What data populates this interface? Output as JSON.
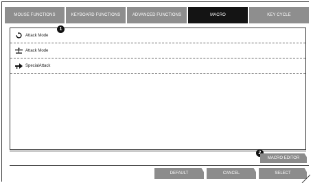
{
  "tabs": [
    {
      "label": "MOUSE FUNCTIONS",
      "active": false
    },
    {
      "label": "KEYBOARD FUNCTIONS",
      "active": false
    },
    {
      "label": "ADVANCED FUNCTIONS",
      "active": false
    },
    {
      "label": "MACRO",
      "active": true
    },
    {
      "label": "KEY CYCLE",
      "active": false
    }
  ],
  "macros": [
    {
      "label": "Attack Mode",
      "icon": "circular-arrows-icon"
    },
    {
      "label": "Attack Mode",
      "icon": "balance-scale-icon"
    },
    {
      "label": "SpecialAttack",
      "icon": "arrow-right-icon"
    }
  ],
  "badges": {
    "one": "1",
    "two": "2"
  },
  "buttons": {
    "macro_editor": "MACRO EDITOR",
    "default": "DEFAULT",
    "cancel": "CANCEL",
    "select": "SELECT"
  },
  "colors": {
    "tab": "#8e8e8e",
    "tab_active": "#141414",
    "button": "#8c8c8c"
  }
}
